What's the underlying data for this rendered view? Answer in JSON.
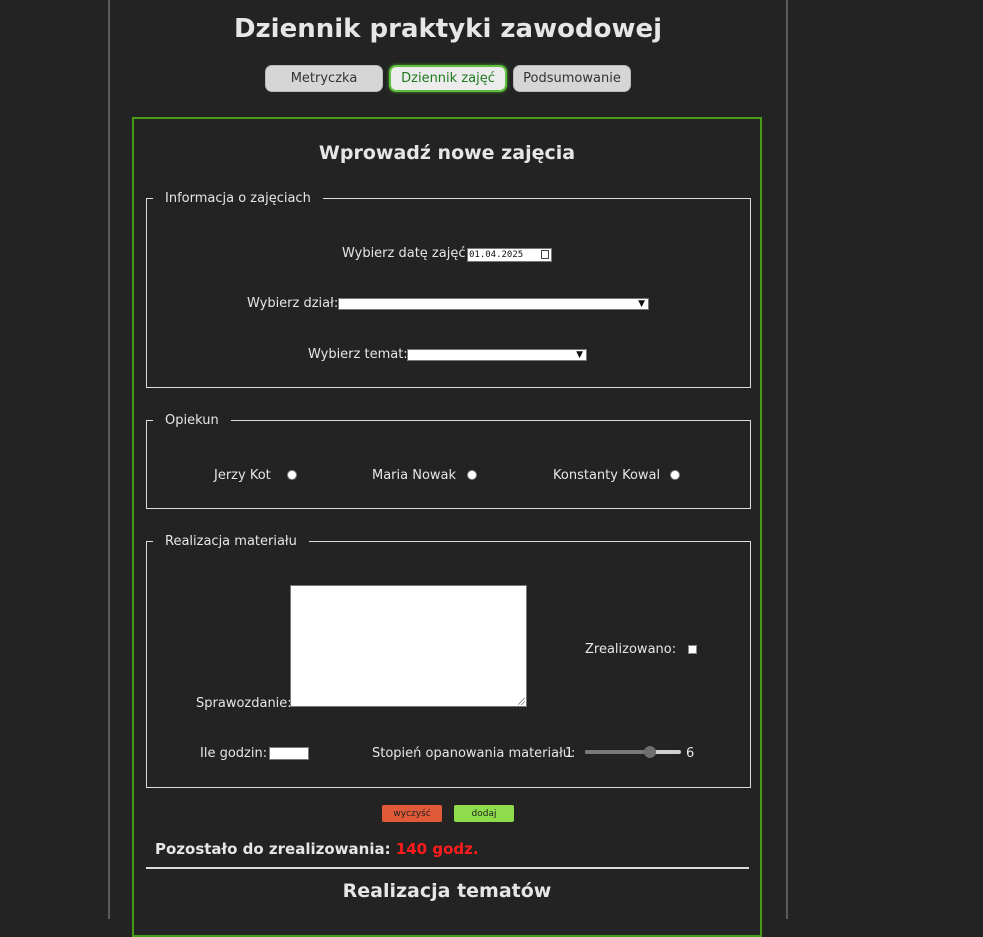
{
  "header": {
    "title": "Dziennik praktyki zawodowej"
  },
  "tabs": [
    {
      "label": "Metryczka",
      "active": false
    },
    {
      "label": "Dziennik zajęć",
      "active": true
    },
    {
      "label": "Podsumowanie",
      "active": false
    }
  ],
  "form": {
    "title": "Wprowadź nowe zajęcia",
    "info": {
      "legend": "Informacja o zajęciach",
      "date_label": "Wybierz datę zajęć:",
      "date_value": "01.04.2025",
      "dept_label": "Wybierz dział:",
      "dept_value": "",
      "topic_label": "Wybierz temat:",
      "topic_value": ""
    },
    "supervisor": {
      "legend": "Opiekun",
      "options": [
        "Jerzy Kot",
        "Maria Nowak",
        "Konstanty Kowal"
      ]
    },
    "material": {
      "legend": "Realizacja materiału",
      "report_label": "Sprawozdanie:",
      "report_value": "",
      "done_label": "Zrealizowano:",
      "done_checked": false,
      "hours_label": "Ile godzin:",
      "hours_value": "",
      "mastery_label": "Stopień opanowania materiału:",
      "mastery_min": "1",
      "mastery_max": "6",
      "mastery_value": 4.5
    },
    "buttons": {
      "clear": "wyczyść",
      "add": "dodaj"
    },
    "remaining": {
      "label": "Pozostało do zrealizowania:",
      "value": "140 godz."
    },
    "topics_title": "Realizacja tematów"
  },
  "colors": {
    "background": "#232323",
    "panel_border": "#4a9a1a",
    "active_tab_text": "#1e7a1e",
    "clear_button": "#e05a3a",
    "add_button": "#8edc4c",
    "remaining_value": "#ff1b1b"
  },
  "icons": {
    "date": "calendar-icon",
    "select": "chevron-down-icon"
  }
}
